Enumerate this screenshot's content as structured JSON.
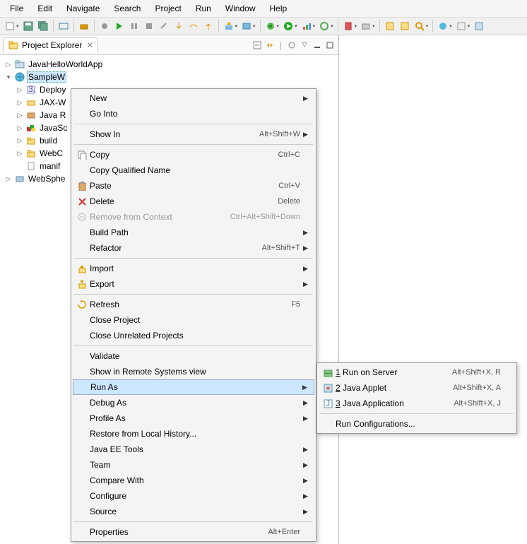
{
  "menubar": [
    "File",
    "Edit",
    "Navigate",
    "Search",
    "Project",
    "Run",
    "Window",
    "Help"
  ],
  "view": {
    "title": "Project Explorer"
  },
  "tree": {
    "root1": "JavaHelloWorldApp",
    "root2_prefix": "SampleW",
    "children": [
      {
        "label": "Deploy",
        "icon": "deploy"
      },
      {
        "label": "JAX-W",
        "icon": "jaxw"
      },
      {
        "label": "Java R",
        "icon": "jar"
      },
      {
        "label": "JavaSc",
        "icon": "js"
      },
      {
        "label": "build",
        "icon": "folder"
      },
      {
        "label": "WebC",
        "icon": "folder"
      },
      {
        "label": "manif",
        "icon": "file",
        "leaf": true
      }
    ],
    "root3": "WebSphe"
  },
  "ctx": [
    {
      "label": "New",
      "arrow": true
    },
    {
      "label": "Go Into"
    },
    {
      "sep": true
    },
    {
      "label": "Show In",
      "shortcut": "Alt+Shift+W",
      "arrow": true
    },
    {
      "sep": true
    },
    {
      "label": "Copy",
      "shortcut": "Ctrl+C",
      "icon": "copy"
    },
    {
      "label": "Copy Qualified Name"
    },
    {
      "label": "Paste",
      "shortcut": "Ctrl+V",
      "icon": "paste"
    },
    {
      "label": "Delete",
      "shortcut": "Delete",
      "icon": "delete"
    },
    {
      "label": "Remove from Context",
      "shortcut": "Ctrl+Alt+Shift+Down",
      "icon": "remove",
      "disabled": true
    },
    {
      "label": "Build Path",
      "arrow": true
    },
    {
      "label": "Refactor",
      "shortcut": "Alt+Shift+T",
      "arrow": true
    },
    {
      "sep": true
    },
    {
      "label": "Import",
      "arrow": true,
      "icon": "import"
    },
    {
      "label": "Export",
      "arrow": true,
      "icon": "export"
    },
    {
      "sep": true
    },
    {
      "label": "Refresh",
      "shortcut": "F5",
      "icon": "refresh"
    },
    {
      "label": "Close Project"
    },
    {
      "label": "Close Unrelated Projects"
    },
    {
      "sep": true
    },
    {
      "label": "Validate"
    },
    {
      "label": "Show in Remote Systems view"
    },
    {
      "label": "Run As",
      "arrow": true,
      "hl": true
    },
    {
      "label": "Debug As",
      "arrow": true
    },
    {
      "label": "Profile As",
      "arrow": true
    },
    {
      "label": "Restore from Local History..."
    },
    {
      "label": "Java EE Tools",
      "arrow": true
    },
    {
      "label": "Team",
      "arrow": true
    },
    {
      "label": "Compare With",
      "arrow": true
    },
    {
      "label": "Configure",
      "arrow": true
    },
    {
      "label": "Source",
      "arrow": true
    },
    {
      "sep": true
    },
    {
      "label": "Properties",
      "shortcut": "Alt+Enter"
    }
  ],
  "submenu": [
    {
      "num": "1",
      "label": "Run on Server",
      "shortcut": "Alt+Shift+X, R",
      "icon": "server"
    },
    {
      "num": "2",
      "label": "Java Applet",
      "shortcut": "Alt+Shift+X, A",
      "icon": "applet"
    },
    {
      "num": "3",
      "label": "Java Application",
      "shortcut": "Alt+Shift+X, J",
      "icon": "japp"
    },
    {
      "sep": true
    },
    {
      "label": "Run Configurations..."
    }
  ]
}
